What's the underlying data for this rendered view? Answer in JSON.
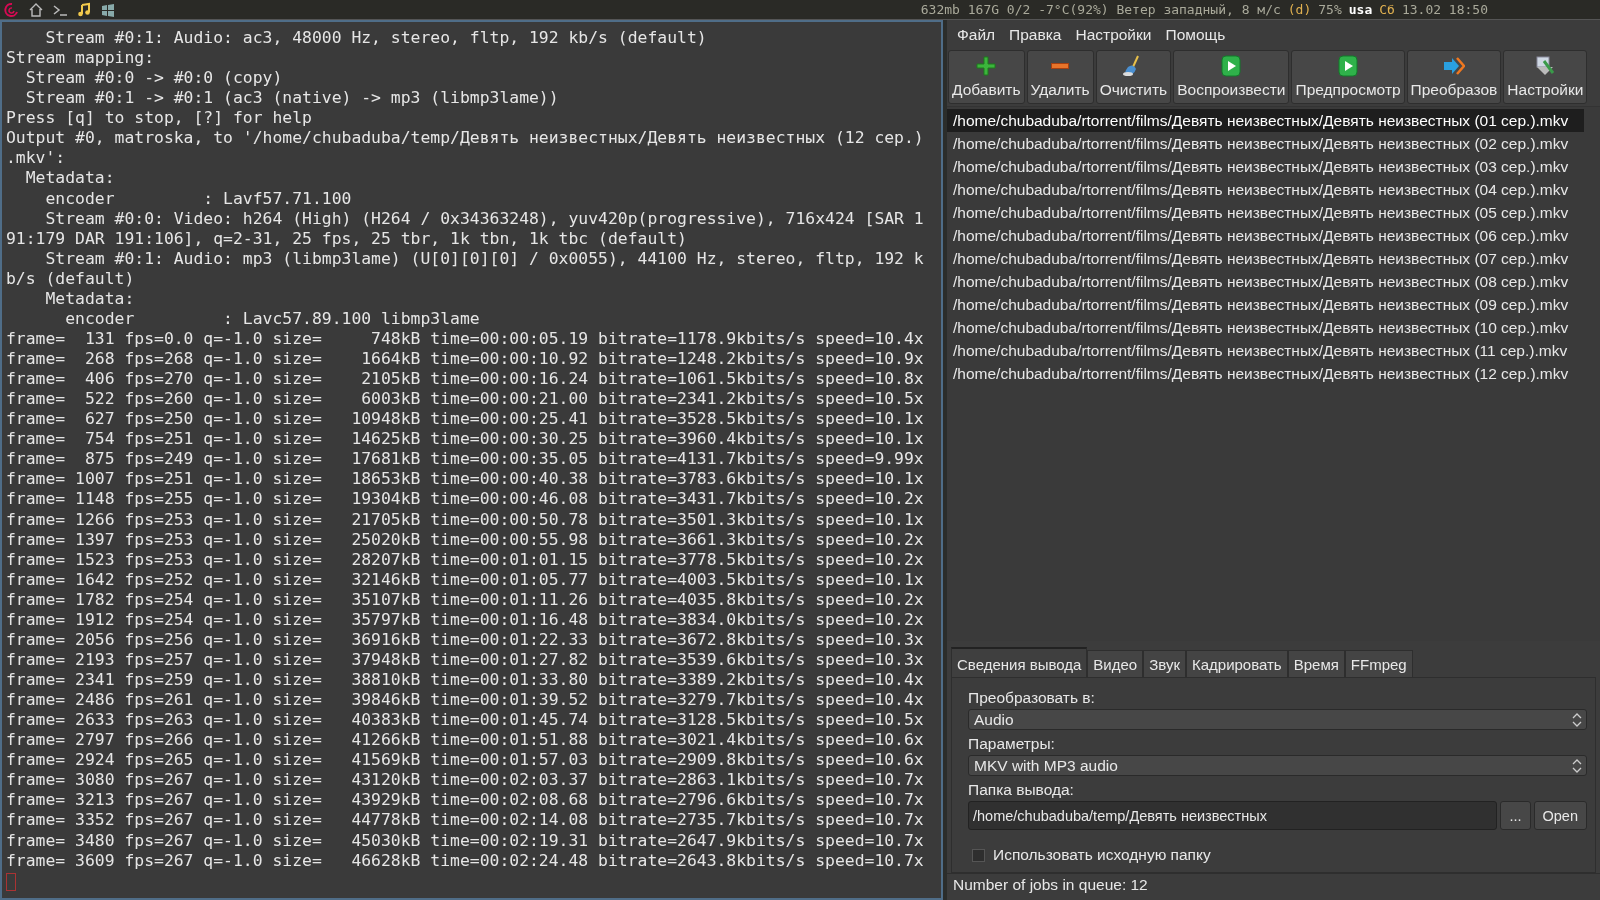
{
  "top_bar": {
    "launchers": [
      {
        "kind": "swirl"
      },
      {
        "kind": "home"
      },
      {
        "kind": "prompt"
      },
      {
        "kind": "music"
      },
      {
        "kind": "flag"
      }
    ],
    "status": [
      {
        "text": "632mb 167G 0/2 -7°C(92%) Ветер западный, 8 м/с",
        "kind": "plain"
      },
      {
        "text": "(d)",
        "kind": "accent"
      },
      {
        "text": "75%",
        "kind": "plain"
      },
      {
        "text": "usa",
        "kind": "bold"
      },
      {
        "text": "Сб",
        "kind": "accent"
      },
      {
        "text": "13.02 18:50",
        "kind": "plain"
      }
    ]
  },
  "terminal": {
    "lines": [
      "    Stream #0:1: Audio: ac3, 48000 Hz, stereo, fltp, 192 kb/s (default)",
      "Stream mapping:",
      "  Stream #0:0 -> #0:0 (copy)",
      "  Stream #0:1 -> #0:1 (ac3 (native) -> mp3 (libmp3lame))",
      "Press [q] to stop, [?] for help",
      "Output #0, matroska, to '/home/chubaduba/temp/Девять неизвестных/Девять неизвестных (12 сер.)",
      ".mkv':",
      "  Metadata:",
      "    encoder         : Lavf57.71.100",
      "    Stream #0:0: Video: h264 (High) (H264 / 0x34363248), yuv420p(progressive), 716x424 [SAR 1",
      "91:179 DAR 191:106], q=2-31, 25 fps, 25 tbr, 1k tbn, 1k tbc (default)",
      "    Stream #0:1: Audio: mp3 (libmp3lame) (U[0][0][0] / 0x0055), 44100 Hz, stereo, fltp, 192 k",
      "b/s (default)",
      "    Metadata:",
      "      encoder         : Lavc57.89.100 libmp3lame",
      "frame=  131 fps=0.0 q=-1.0 size=     748kB time=00:00:05.19 bitrate=1178.9kbits/s speed=10.4x",
      "frame=  268 fps=268 q=-1.0 size=    1664kB time=00:00:10.92 bitrate=1248.2kbits/s speed=10.9x",
      "frame=  406 fps=270 q=-1.0 size=    2105kB time=00:00:16.24 bitrate=1061.5kbits/s speed=10.8x",
      "frame=  522 fps=260 q=-1.0 size=    6003kB time=00:00:21.00 bitrate=2341.2kbits/s speed=10.5x",
      "frame=  627 fps=250 q=-1.0 size=   10948kB time=00:00:25.41 bitrate=3528.5kbits/s speed=10.1x",
      "frame=  754 fps=251 q=-1.0 size=   14625kB time=00:00:30.25 bitrate=3960.4kbits/s speed=10.1x",
      "frame=  875 fps=249 q=-1.0 size=   17681kB time=00:00:35.05 bitrate=4131.7kbits/s speed=9.99x",
      "frame= 1007 fps=251 q=-1.0 size=   18653kB time=00:00:40.38 bitrate=3783.6kbits/s speed=10.1x",
      "frame= 1148 fps=255 q=-1.0 size=   19304kB time=00:00:46.08 bitrate=3431.7kbits/s speed=10.2x",
      "frame= 1266 fps=253 q=-1.0 size=   21705kB time=00:00:50.78 bitrate=3501.3kbits/s speed=10.1x",
      "frame= 1397 fps=253 q=-1.0 size=   25020kB time=00:00:55.98 bitrate=3661.3kbits/s speed=10.2x",
      "frame= 1523 fps=253 q=-1.0 size=   28207kB time=00:01:01.15 bitrate=3778.5kbits/s speed=10.2x",
      "frame= 1642 fps=252 q=-1.0 size=   32146kB time=00:01:05.77 bitrate=4003.5kbits/s speed=10.1x",
      "frame= 1782 fps=254 q=-1.0 size=   35107kB time=00:01:11.26 bitrate=4035.8kbits/s speed=10.2x",
      "frame= 1912 fps=254 q=-1.0 size=   35797kB time=00:01:16.48 bitrate=3834.0kbits/s speed=10.2x",
      "frame= 2056 fps=256 q=-1.0 size=   36916kB time=00:01:22.33 bitrate=3672.8kbits/s speed=10.3x",
      "frame= 2193 fps=257 q=-1.0 size=   37948kB time=00:01:27.82 bitrate=3539.6kbits/s speed=10.3x",
      "frame= 2341 fps=259 q=-1.0 size=   38810kB time=00:01:33.80 bitrate=3389.2kbits/s speed=10.4x",
      "frame= 2486 fps=261 q=-1.0 size=   39846kB time=00:01:39.52 bitrate=3279.7kbits/s speed=10.4x",
      "frame= 2633 fps=263 q=-1.0 size=   40383kB time=00:01:45.74 bitrate=3128.5kbits/s speed=10.5x",
      "frame= 2797 fps=266 q=-1.0 size=   41266kB time=00:01:51.88 bitrate=3021.4kbits/s speed=10.6x",
      "frame= 2924 fps=265 q=-1.0 size=   41569kB time=00:01:57.03 bitrate=2909.8kbits/s speed=10.6x",
      "frame= 3080 fps=267 q=-1.0 size=   43120kB time=00:02:03.37 bitrate=2863.1kbits/s speed=10.7x",
      "frame= 3213 fps=267 q=-1.0 size=   43929kB time=00:02:08.68 bitrate=2796.6kbits/s speed=10.7x",
      "frame= 3352 fps=267 q=-1.0 size=   44778kB time=00:02:14.08 bitrate=2735.7kbits/s speed=10.7x",
      "frame= 3480 fps=267 q=-1.0 size=   45030kB time=00:02:19.31 bitrate=2647.9kbits/s speed=10.7x",
      "frame= 3609 fps=267 q=-1.0 size=   46628kB time=00:02:24.48 bitrate=2643.8kbits/s speed=10.7x"
    ]
  },
  "app": {
    "menu": [
      "Файл",
      "Правка",
      "Настройки",
      "Помощь"
    ],
    "toolbar": [
      {
        "label": "Добавить",
        "kind": "add"
      },
      {
        "label": "Удалить",
        "kind": "remove"
      },
      {
        "label": "Очистить",
        "kind": "broom"
      },
      {
        "label": "Воспроизвести",
        "kind": "play"
      },
      {
        "label": "Предпросмотр",
        "kind": "play"
      },
      {
        "label": "Преобразов",
        "kind": "convert"
      },
      {
        "label": "Настройки",
        "kind": "tools"
      }
    ],
    "queue": [
      {
        "path": "/home/chubaduba/rtorrent/films/Девять неизвестных/Девять неизвестных (01 сер.).mkv",
        "selected": true
      },
      {
        "path": "/home/chubaduba/rtorrent/films/Девять неизвестных/Девять неизвестных (02 сер.).mkv",
        "selected": false
      },
      {
        "path": "/home/chubaduba/rtorrent/films/Девять неизвестных/Девять неизвестных (03 сер.).mkv",
        "selected": false
      },
      {
        "path": "/home/chubaduba/rtorrent/films/Девять неизвестных/Девять неизвестных (04 сер.).mkv",
        "selected": false
      },
      {
        "path": "/home/chubaduba/rtorrent/films/Девять неизвестных/Девять неизвестных (05 сер.).mkv",
        "selected": false
      },
      {
        "path": "/home/chubaduba/rtorrent/films/Девять неизвестных/Девять неизвестных (06 сер.).mkv",
        "selected": false
      },
      {
        "path": "/home/chubaduba/rtorrent/films/Девять неизвестных/Девять неизвестных (07 сер.).mkv",
        "selected": false
      },
      {
        "path": "/home/chubaduba/rtorrent/films/Девять неизвестных/Девять неизвестных (08 сер.).mkv",
        "selected": false
      },
      {
        "path": "/home/chubaduba/rtorrent/films/Девять неизвестных/Девять неизвестных (09 сер.).mkv",
        "selected": false
      },
      {
        "path": "/home/chubaduba/rtorrent/films/Девять неизвестных/Девять неизвестных (10 сер.).mkv",
        "selected": false
      },
      {
        "path": "/home/chubaduba/rtorrent/films/Девять неизвестных/Девять неизвестных (11 сер.).mkv",
        "selected": false
      },
      {
        "path": "/home/chubaduba/rtorrent/films/Девять неизвестных/Девять неизвестных (12 сер.).mkv",
        "selected": false
      }
    ],
    "tabs": [
      {
        "label": "Сведения вывода",
        "selected": true
      },
      {
        "label": "Видео",
        "selected": false
      },
      {
        "label": "Звук",
        "selected": false
      },
      {
        "label": "Кадрировать",
        "selected": false
      },
      {
        "label": "Время",
        "selected": false
      },
      {
        "label": "FFmpeg",
        "selected": false
      }
    ],
    "convert_to": {
      "label": "Преобразовать в:",
      "value": "Audio"
    },
    "parameters": {
      "label": "Параметры:",
      "value": "MKV with MP3 audio"
    },
    "output_folder": {
      "label": "Папка вывода:",
      "value": "/home/chubaduba/temp/Девять неизвестных",
      "buttons": [
        "...",
        "Open"
      ]
    },
    "use_source_folder": {
      "label": "Использовать исходную папку",
      "checked": false
    },
    "status_bar": "Number of jobs in queue: 12"
  }
}
